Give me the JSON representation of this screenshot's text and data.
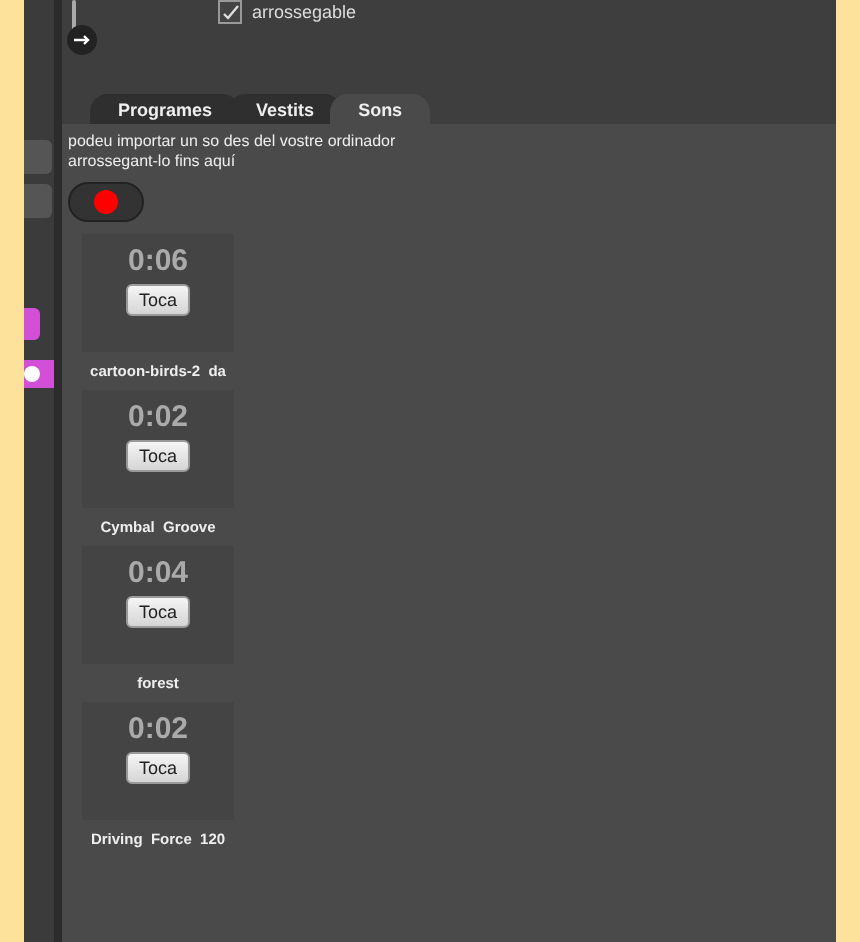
{
  "top": {
    "checkbox": {
      "label": "arrossegable",
      "checked": true
    }
  },
  "tabs": [
    {
      "label": "Programes",
      "selected": false
    },
    {
      "label": "Vestits",
      "selected": false
    },
    {
      "label": "Sons",
      "selected": true
    }
  ],
  "hint": "podeu importar un so des del vostre ordinador arrossegant-lo fins aquí",
  "sounds": [
    {
      "duration": "0:06",
      "button": "Toca",
      "name": "cartoon-birds-2  da"
    },
    {
      "duration": "0:02",
      "button": "Toca",
      "name": "Cymbal  Groove"
    },
    {
      "duration": "0:04",
      "button": "Toca",
      "name": "forest"
    },
    {
      "duration": "0:02",
      "button": "Toca",
      "name": "Driving  Force  120"
    }
  ]
}
